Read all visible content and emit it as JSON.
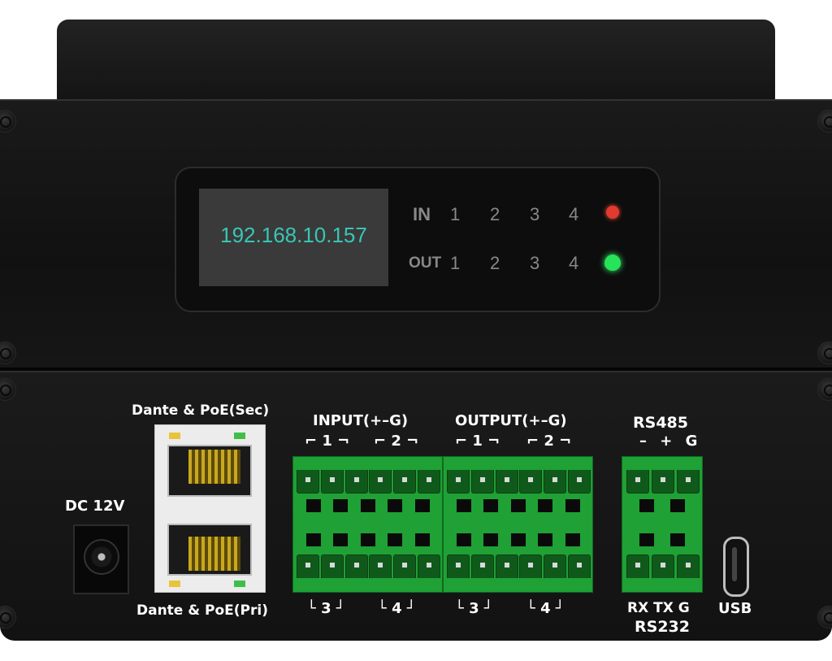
{
  "display": {
    "ip_address": "192.168.10.157",
    "in_label": "IN",
    "out_label": "OUT",
    "channels": [
      "1",
      "2",
      "3",
      "4"
    ],
    "in_led_color": "#e23a2e",
    "out_led_color": "#27e35a",
    "ip_color": "#38c6b5"
  },
  "ports": {
    "dc": "DC 12V",
    "dante_sec": "Dante & PoE(Sec)",
    "dante_pri": "Dante & PoE(Pri)",
    "input_title": "INPUT(+–G)",
    "output_title": "OUTPUT(+–G)",
    "rs485": "RS485",
    "rs485_pins": "– + G",
    "rs232_pins": "RX TX G",
    "rs232": "RS232",
    "usb": "USB",
    "input_top": [
      "1",
      "2"
    ],
    "input_bottom": [
      "3",
      "4"
    ],
    "output_top": [
      "1",
      "2"
    ],
    "output_bottom": [
      "3",
      "4"
    ]
  },
  "colors": {
    "terminal_green": "#1fa135",
    "chassis": "#141414"
  }
}
